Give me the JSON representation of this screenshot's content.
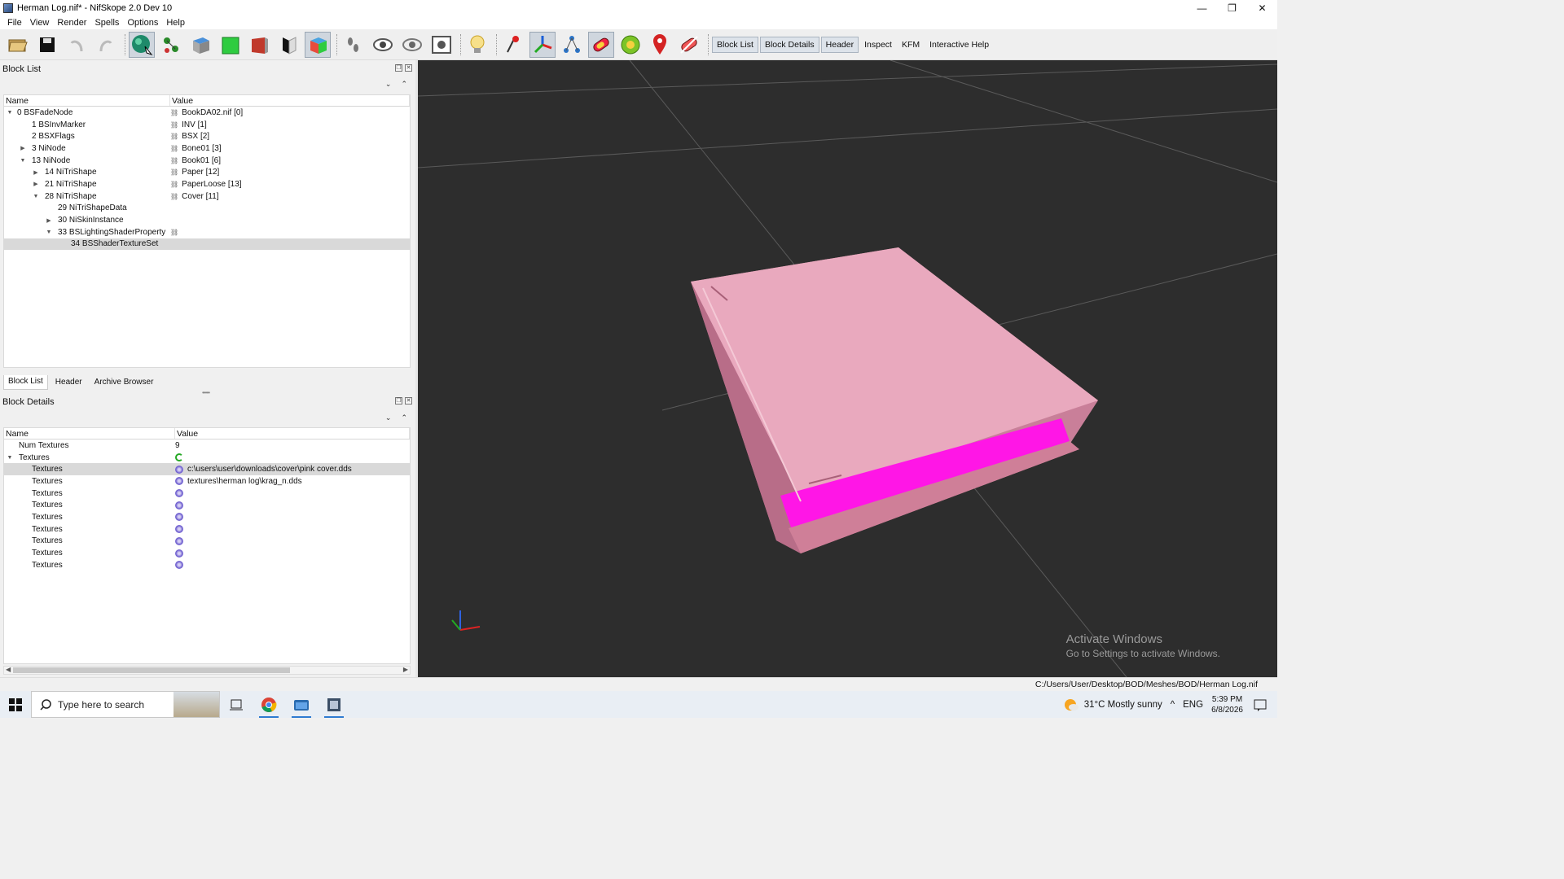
{
  "window": {
    "title": "Herman Log.nif* - NifSkope 2.0 Dev 10",
    "controls": [
      "—",
      "❐",
      "✕"
    ]
  },
  "menu": [
    "File",
    "View",
    "Render",
    "Spells",
    "Options",
    "Help"
  ],
  "toolbar": {
    "text_buttons": [
      "Block List",
      "Block Details",
      "Header",
      "Inspect",
      "KFM",
      "Interactive Help"
    ]
  },
  "block_list": {
    "title": "Block List",
    "columns": [
      "Name",
      "Value"
    ],
    "rows": [
      {
        "name": "0 BSFadeNode",
        "value": "BookDA02.nif [0]"
      },
      {
        "name": "1 BSInvMarker",
        "value": "INV [1]"
      },
      {
        "name": "2 BSXFlags",
        "value": "BSX [2]"
      },
      {
        "name": "3 NiNode",
        "value": "Bone01 [3]"
      },
      {
        "name": "13 NiNode",
        "value": "Book01 [6]"
      },
      {
        "name": "14 NiTriShape",
        "value": "Paper [12]"
      },
      {
        "name": "21 NiTriShape",
        "value": "PaperLoose [13]"
      },
      {
        "name": "28 NiTriShape",
        "value": "Cover [11]"
      },
      {
        "name": "29 NiTriShapeData",
        "value": ""
      },
      {
        "name": "30 NiSkinInstance",
        "value": ""
      },
      {
        "name": "33 BSLightingShaderProperty",
        "value": ""
      },
      {
        "name": "34 BSShaderTextureSet",
        "value": ""
      }
    ],
    "tabs": [
      "Block List",
      "Header",
      "Archive Browser"
    ]
  },
  "block_details": {
    "title": "Block Details",
    "columns": [
      "Name",
      "Value"
    ],
    "num_textures": {
      "name": "Num Textures",
      "value": "9"
    },
    "textures_group": "Textures",
    "textures": [
      {
        "name": "Textures",
        "value": "c:\\users\\user\\downloads\\cover\\pink cover.dds"
      },
      {
        "name": "Textures",
        "value": "textures\\herman log\\krag_n.dds"
      },
      {
        "name": "Textures",
        "value": ""
      },
      {
        "name": "Textures",
        "value": ""
      },
      {
        "name": "Textures",
        "value": ""
      },
      {
        "name": "Textures",
        "value": ""
      },
      {
        "name": "Textures",
        "value": ""
      },
      {
        "name": "Textures",
        "value": ""
      },
      {
        "name": "Textures",
        "value": ""
      }
    ]
  },
  "viewport": {
    "watermark_title": "Activate Windows",
    "watermark_sub": "Go to Settings to activate Windows."
  },
  "status": {
    "path": "C:/Users/User/Desktop/BOD/Meshes/BOD/Herman Log.nif"
  },
  "taskbar": {
    "search_placeholder": "Type here to search",
    "weather": "31°C  Mostly sunny",
    "lang": "ENG",
    "time": "5:39 PM",
    "date": "6/8/2026"
  }
}
